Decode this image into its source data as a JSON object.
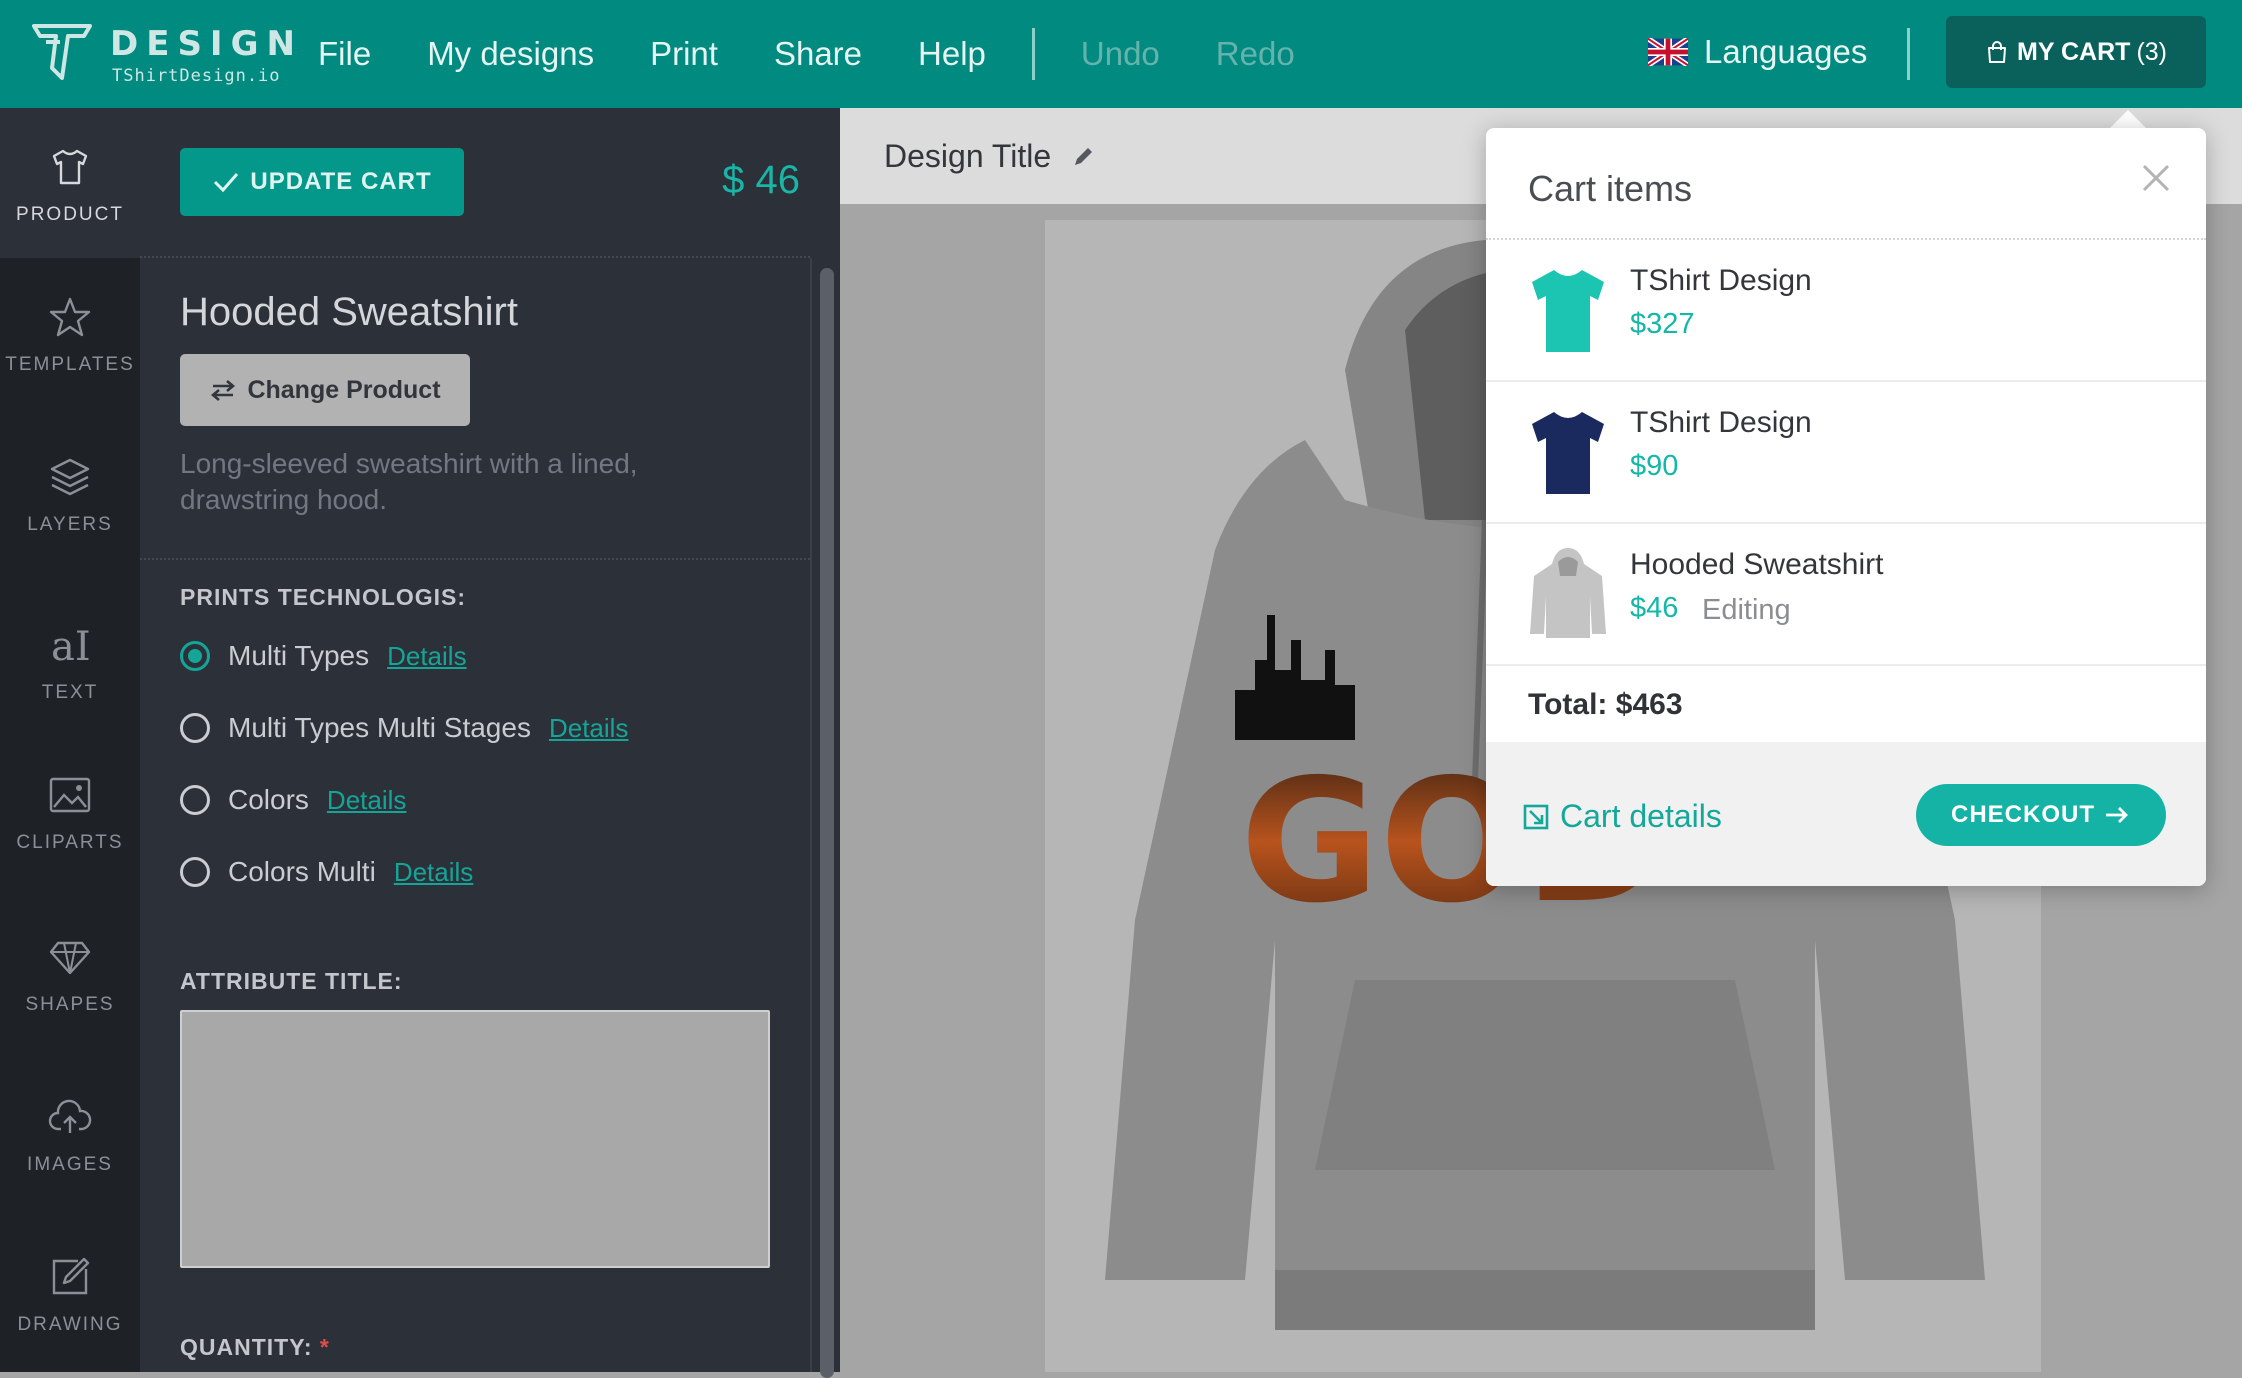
{
  "app": {
    "logo_title": "DESIGN",
    "logo_subtitle": "TShirtDesign.io"
  },
  "menu": {
    "file": "File",
    "my_designs": "My designs",
    "print": "Print",
    "share": "Share",
    "help": "Help",
    "undo": "Undo",
    "redo": "Redo"
  },
  "header": {
    "languages": "Languages",
    "cart_label": "MY CART",
    "cart_count": "(3)"
  },
  "rail": {
    "items": [
      {
        "label": "PRODUCT",
        "icon": "tshirt-icon",
        "active": true
      },
      {
        "label": "TEMPLATES",
        "icon": "star-icon"
      },
      {
        "label": "LAYERS",
        "icon": "layers-icon"
      },
      {
        "label": "TEXT",
        "icon": "text-icon"
      },
      {
        "label": "CLIPARTS",
        "icon": "image-icon"
      },
      {
        "label": "SHAPES",
        "icon": "diamond-icon"
      },
      {
        "label": "IMAGES",
        "icon": "cloud-upload-icon"
      },
      {
        "label": "DRAWING",
        "icon": "pencil-icon"
      }
    ]
  },
  "panel": {
    "update_cart": "UPDATE CART",
    "price": "$ 46",
    "product_name": "Hooded Sweatshirt",
    "change_product": "Change Product",
    "description": "Long-sleeved sweatshirt with a lined, drawstring hood.",
    "prints_label": "PRINTS TECHNOLOGIS:",
    "print_options": [
      {
        "label": "Multi Types",
        "link": "Details",
        "checked": true
      },
      {
        "label": "Multi Types Multi Stages",
        "link": "Details",
        "checked": false
      },
      {
        "label": "Colors",
        "link": "Details",
        "checked": false
      },
      {
        "label": "Colors Multi",
        "link": "Details",
        "checked": false
      }
    ],
    "attribute_label": "ATTRIBUTE TITLE:",
    "attribute_value": "",
    "quantity_label": "QUANTITY:",
    "quantity_required": "*"
  },
  "canvas": {
    "design_title": "Design Title",
    "print_text": "GOD"
  },
  "cart_popover": {
    "title": "Cart items",
    "items": [
      {
        "name": "TShirt Design",
        "price": "$327",
        "status": "",
        "color": "#1cc5b1"
      },
      {
        "name": "TShirt Design",
        "price": "$90",
        "status": "",
        "color": "#1a2a5e"
      },
      {
        "name": "Hooded Sweatshirt",
        "price": "$46",
        "status": "Editing",
        "color": "#c4c4c4"
      }
    ],
    "total": "Total: $463",
    "cart_details": "Cart details",
    "checkout": "CHECKOUT"
  },
  "colors": {
    "topbar": "#008a80",
    "accent": "#15b3a6",
    "rail": "#1e2227",
    "panel": "#2c3038"
  }
}
